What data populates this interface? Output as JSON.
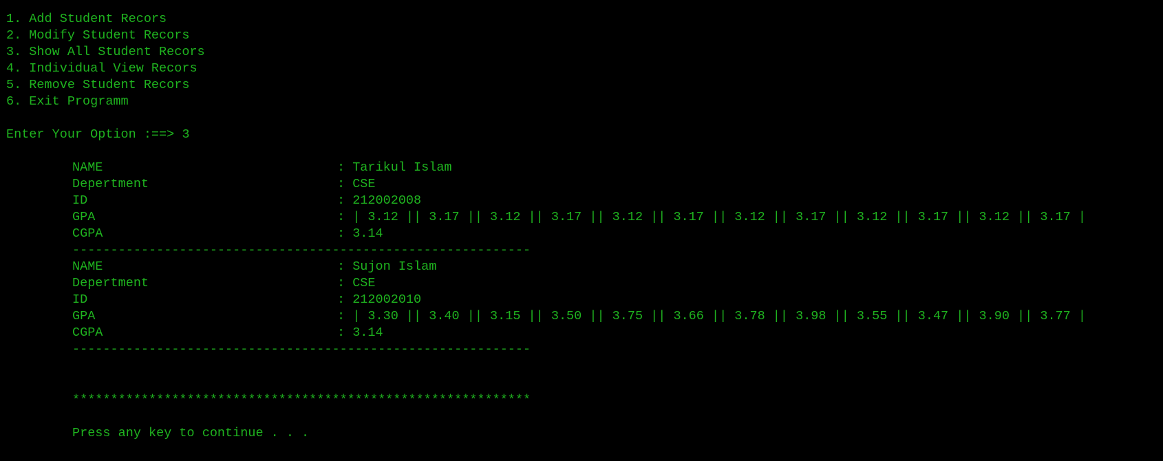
{
  "menu": {
    "items": [
      "1. Add Student Recors",
      "2. Modify Student Recors",
      "3. Show All Student Recors",
      "4. Individual View Recors",
      "5. Remove Student Recors",
      "6. Exit Programm"
    ]
  },
  "prompt": {
    "label": "Enter Your Option :==> ",
    "value": "3"
  },
  "labels": {
    "name": "NAME",
    "department": "Depertment",
    "id": "ID",
    "gpa": "GPA",
    "cgpa": "CGPA"
  },
  "records": [
    {
      "name": ": Tarikul Islam",
      "department": ": CSE",
      "id": ": 212002008",
      "gpa": ": | 3.12 || 3.17 || 3.12 || 3.17 || 3.12 || 3.17 || 3.12 || 3.17 || 3.12 || 3.17 || 3.12 || 3.17 |",
      "cgpa": ": 3.14"
    },
    {
      "name": ": Sujon Islam",
      "department": ": CSE",
      "id": ": 212002010",
      "gpa": ": | 3.30 || 3.40 || 3.15 || 3.50 || 3.75 || 3.66 || 3.78 || 3.98 || 3.55 || 3.47 || 3.90 || 3.77 |",
      "cgpa": ": 3.14"
    }
  ],
  "separator": "------------------------------------------------------------",
  "stars": "************************************************************",
  "continue_prompt": "Press any key to continue . . .",
  "colors": {
    "background": "#000000",
    "text": "#1fb31f"
  }
}
